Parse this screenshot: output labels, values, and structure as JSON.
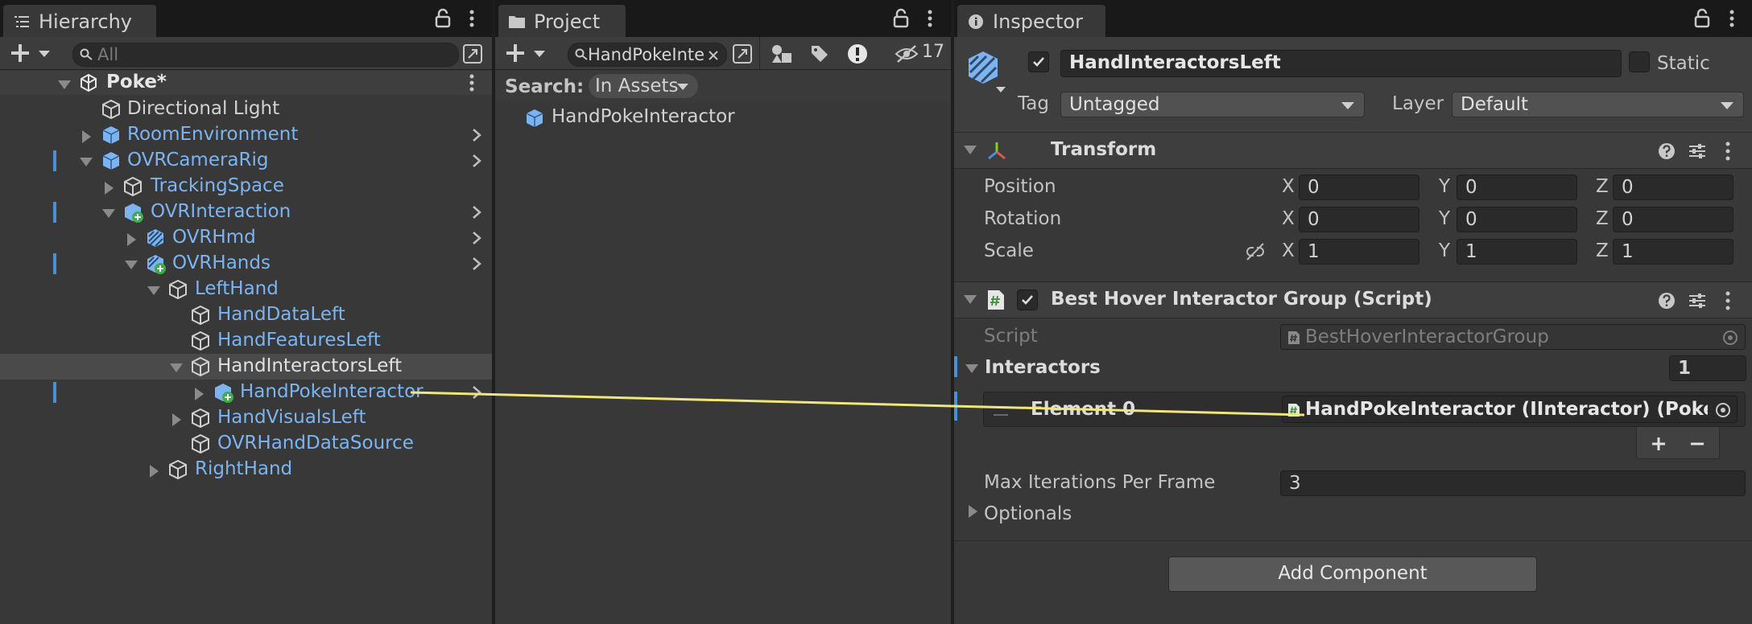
{
  "hierarchy": {
    "tab_label": "Hierarchy",
    "search_placeholder": "All",
    "scene": "Poke*",
    "items": [
      {
        "label": "Directional Light"
      },
      {
        "label": "RoomEnvironment"
      },
      {
        "label": "OVRCameraRig"
      },
      {
        "label": "TrackingSpace"
      },
      {
        "label": "OVRInteraction"
      },
      {
        "label": "OVRHmd"
      },
      {
        "label": "OVRHands"
      },
      {
        "label": "LeftHand"
      },
      {
        "label": "HandDataLeft"
      },
      {
        "label": "HandFeaturesLeft"
      },
      {
        "label": "HandInteractorsLeft"
      },
      {
        "label": "HandPokeInteractor"
      },
      {
        "label": "HandVisualsLeft"
      },
      {
        "label": "OVRHandDataSource"
      },
      {
        "label": "RightHand"
      }
    ]
  },
  "project": {
    "tab_label": "Project",
    "search_value": "HandPokeInte",
    "hidden_count": "17",
    "search_label": "Search:",
    "scope_label": "In Assets",
    "results": [
      {
        "label": "HandPokeInteractor"
      }
    ]
  },
  "inspector": {
    "tab_label": "Inspector",
    "object_name": "HandInteractorsLeft",
    "static_label": "Static",
    "tag_label": "Tag",
    "tag_value": "Untagged",
    "layer_label": "Layer",
    "layer_value": "Default",
    "transform": {
      "title": "Transform",
      "position_label": "Position",
      "rotation_label": "Rotation",
      "scale_label": "Scale",
      "axis_x": "X",
      "axis_y": "Y",
      "axis_z": "Z",
      "position": [
        "0",
        "0",
        "0"
      ],
      "rotation": [
        "0",
        "0",
        "0"
      ],
      "scale": [
        "1",
        "1",
        "1"
      ]
    },
    "script_component": {
      "title": "Best Hover Interactor Group (Script)",
      "script_label": "Script",
      "script_value": "BestHoverInteractorGroup",
      "interactors_label": "Interactors",
      "interactors_count": "1",
      "element_label": "Element 0",
      "element_value": "HandPokeInteractor (IInteractor) (Poke Ir",
      "max_iter_label": "Max Iterations Per Frame",
      "max_iter_value": "3",
      "optionals_label": "Optionals"
    },
    "add_component_label": "Add Component"
  },
  "colors": {
    "accent_blue": "#4a90d6",
    "prefab_text": "#7cb4f2",
    "drag_line": "#f0e67a"
  }
}
